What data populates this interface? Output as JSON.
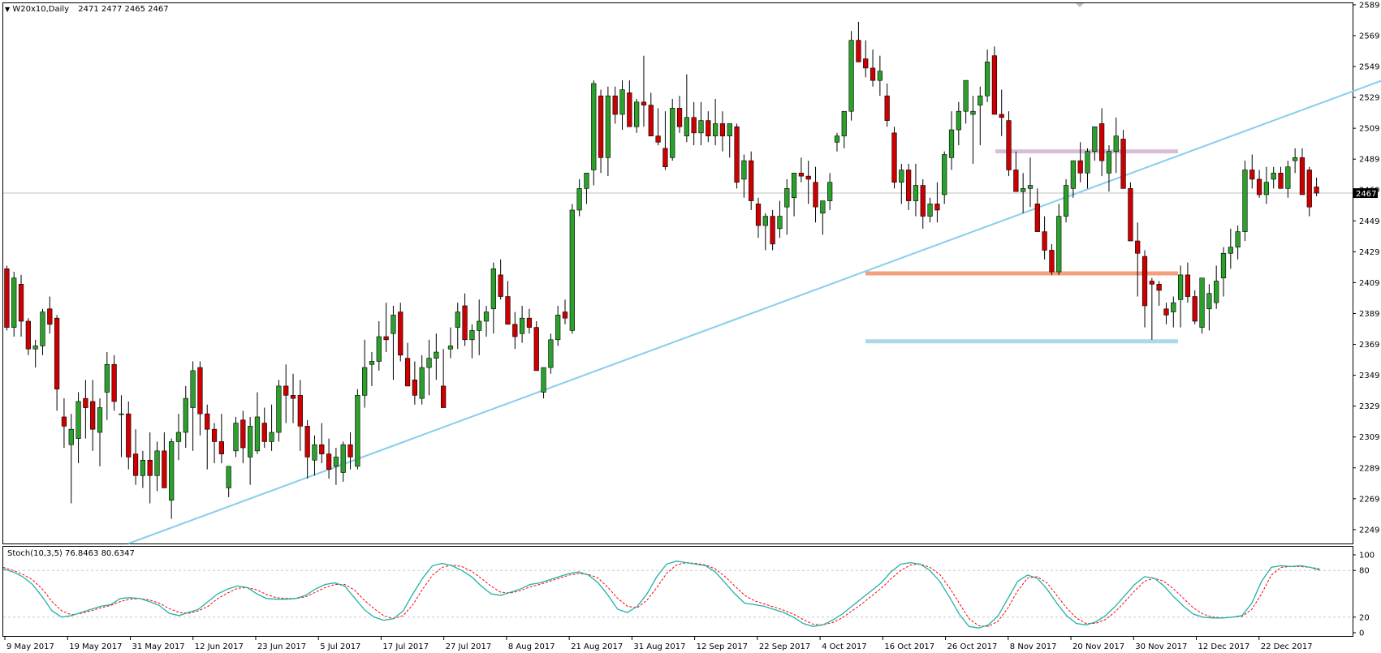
{
  "header": {
    "symbol": "W20x10,Daily",
    "ohlc": "2471 2477 2465 2467"
  },
  "indicator": {
    "title": "Stoch(10,3,5)",
    "values": "76.8463 80.6347",
    "levels": [
      20,
      80
    ],
    "scale": [
      "100",
      "80",
      "20",
      "0"
    ]
  },
  "colors": {
    "bull": "#2ca02c",
    "bear": "#cc0000",
    "trendline": "#87ceeb",
    "resistance_zone": "#d8bfd8",
    "support_mid": "#f4a07c",
    "support_low": "#add8e6",
    "stoch_main": "#20b2aa",
    "stoch_signal": "#ff0000"
  },
  "chart_data": {
    "type": "candlestick",
    "current_price": "2467",
    "ylim": [
      2240,
      2590
    ],
    "y_ticks": [
      2589,
      2569,
      2549,
      2529,
      2509,
      2489,
      2469,
      2449,
      2429,
      2409,
      2389,
      2369,
      2349,
      2329,
      2309,
      2289,
      2269,
      2249
    ],
    "x_ticks": [
      "9 May 2017",
      "19 May 2017",
      "31 May 2017",
      "12 Jun 2017",
      "23 Jun 2017",
      "5 Jul 2017",
      "17 Jul 2017",
      "27 Jul 2017",
      "8 Aug 2017",
      "21 Aug 2017",
      "31 Aug 2017",
      "12 Sep 2017",
      "22 Sep 2017",
      "4 Oct 2017",
      "16 Oct 2017",
      "26 Oct 2017",
      "8 Nov 2017",
      "20 Nov 2017",
      "30 Nov 2017",
      "12 Dec 2017",
      "22 Dec 2017"
    ],
    "horizontal_levels": [
      {
        "price": 2494,
        "role": "resistance"
      },
      {
        "price": 2415,
        "role": "support"
      },
      {
        "price": 2371,
        "role": "support"
      }
    ],
    "trendline": {
      "start": [
        0,
        2240
      ],
      "end": [
        196,
        2566
      ]
    },
    "candles": [
      [
        2418,
        2420,
        2378,
        2380
      ],
      [
        2380,
        2416,
        2374,
        2412
      ],
      [
        2408,
        2414,
        2374,
        2384
      ],
      [
        2384,
        2386,
        2362,
        2366
      ],
      [
        2366,
        2372,
        2354,
        2368
      ],
      [
        2368,
        2392,
        2362,
        2390
      ],
      [
        2392,
        2400,
        2376,
        2382
      ],
      [
        2386,
        2388,
        2326,
        2340
      ],
      [
        2322,
        2334,
        2302,
        2316
      ],
      [
        2304,
        2324,
        2266,
        2314
      ],
      [
        2308,
        2338,
        2292,
        2332
      ],
      [
        2334,
        2346,
        2308,
        2328
      ],
      [
        2332,
        2346,
        2300,
        2314
      ],
      [
        2312,
        2334,
        2290,
        2328
      ],
      [
        2338,
        2364,
        2320,
        2356
      ],
      [
        2356,
        2362,
        2326,
        2332
      ],
      [
        2324,
        2336,
        2296,
        2324
      ],
      [
        2324,
        2332,
        2288,
        2296
      ],
      [
        2298,
        2314,
        2278,
        2284
      ],
      [
        2284,
        2300,
        2276,
        2294
      ],
      [
        2294,
        2312,
        2266,
        2284
      ],
      [
        2284,
        2306,
        2274,
        2300
      ],
      [
        2300,
        2312,
        2282,
        2276
      ],
      [
        2268,
        2308,
        2256,
        2306
      ],
      [
        2306,
        2324,
        2294,
        2312
      ],
      [
        2312,
        2342,
        2302,
        2334
      ],
      [
        2328,
        2358,
        2300,
        2352
      ],
      [
        2354,
        2358,
        2310,
        2324
      ],
      [
        2324,
        2330,
        2288,
        2314
      ],
      [
        2314,
        2318,
        2292,
        2306
      ],
      [
        2306,
        2324,
        2292,
        2298
      ],
      [
        2276,
        2290,
        2270,
        2290
      ],
      [
        2300,
        2322,
        2296,
        2318
      ],
      [
        2320,
        2326,
        2292,
        2302
      ],
      [
        2296,
        2322,
        2278,
        2316
      ],
      [
        2300,
        2338,
        2298,
        2322
      ],
      [
        2318,
        2328,
        2302,
        2306
      ],
      [
        2306,
        2330,
        2300,
        2312
      ],
      [
        2312,
        2346,
        2306,
        2342
      ],
      [
        2342,
        2356,
        2318,
        2336
      ],
      [
        2336,
        2350,
        2318,
        2334
      ],
      [
        2336,
        2346,
        2300,
        2316
      ],
      [
        2316,
        2320,
        2282,
        2296
      ],
      [
        2294,
        2310,
        2284,
        2304
      ],
      [
        2304,
        2318,
        2292,
        2298
      ],
      [
        2298,
        2308,
        2282,
        2288
      ],
      [
        2290,
        2302,
        2278,
        2296
      ],
      [
        2286,
        2306,
        2280,
        2304
      ],
      [
        2304,
        2312,
        2288,
        2296
      ],
      [
        2290,
        2340,
        2288,
        2336
      ],
      [
        2336,
        2372,
        2328,
        2354
      ],
      [
        2356,
        2364,
        2342,
        2358
      ],
      [
        2358,
        2384,
        2352,
        2374
      ],
      [
        2374,
        2396,
        2364,
        2372
      ],
      [
        2376,
        2394,
        2346,
        2388
      ],
      [
        2390,
        2396,
        2358,
        2362
      ],
      [
        2360,
        2370,
        2346,
        2342
      ],
      [
        2346,
        2358,
        2330,
        2336
      ],
      [
        2334,
        2362,
        2330,
        2354
      ],
      [
        2354,
        2372,
        2336,
        2360
      ],
      [
        2360,
        2376,
        2346,
        2364
      ],
      [
        2342,
        2366,
        2332,
        2328
      ],
      [
        2366,
        2380,
        2360,
        2368
      ],
      [
        2380,
        2396,
        2366,
        2390
      ],
      [
        2394,
        2402,
        2368,
        2372
      ],
      [
        2372,
        2382,
        2360,
        2378
      ],
      [
        2378,
        2398,
        2362,
        2384
      ],
      [
        2384,
        2394,
        2374,
        2390
      ],
      [
        2392,
        2422,
        2376,
        2418
      ],
      [
        2414,
        2424,
        2398,
        2400
      ],
      [
        2400,
        2410,
        2386,
        2382
      ],
      [
        2382,
        2390,
        2366,
        2374
      ],
      [
        2376,
        2394,
        2370,
        2386
      ],
      [
        2386,
        2392,
        2376,
        2380
      ],
      [
        2380,
        2384,
        2356,
        2352
      ],
      [
        2338,
        2342,
        2334,
        2354
      ],
      [
        2354,
        2376,
        2350,
        2372
      ],
      [
        2372,
        2394,
        2368,
        2388
      ],
      [
        2390,
        2398,
        2382,
        2386
      ],
      [
        2378,
        2460,
        2376,
        2456
      ],
      [
        2456,
        2476,
        2452,
        2470
      ],
      [
        2470,
        2478,
        2460,
        2480
      ],
      [
        2482,
        2540,
        2472,
        2538
      ],
      [
        2530,
        2534,
        2480,
        2490
      ],
      [
        2490,
        2536,
        2478,
        2530
      ],
      [
        2530,
        2536,
        2512,
        2518
      ],
      [
        2518,
        2540,
        2508,
        2534
      ],
      [
        2532,
        2540,
        2510,
        2510
      ],
      [
        2510,
        2528,
        2506,
        2526
      ],
      [
        2526,
        2556,
        2510,
        2524
      ],
      [
        2524,
        2532,
        2510,
        2504
      ],
      [
        2504,
        2522,
        2498,
        2500
      ],
      [
        2496,
        2520,
        2482,
        2484
      ],
      [
        2490,
        2528,
        2488,
        2522
      ],
      [
        2522,
        2530,
        2506,
        2510
      ],
      [
        2504,
        2544,
        2500,
        2516
      ],
      [
        2516,
        2526,
        2498,
        2506
      ],
      [
        2506,
        2526,
        2498,
        2514
      ],
      [
        2514,
        2520,
        2500,
        2504
      ],
      [
        2504,
        2528,
        2498,
        2512
      ],
      [
        2512,
        2520,
        2494,
        2504
      ],
      [
        2504,
        2512,
        2490,
        2512
      ],
      [
        2510,
        2512,
        2470,
        2474
      ],
      [
        2476,
        2492,
        2464,
        2488
      ],
      [
        2488,
        2494,
        2456,
        2462
      ],
      [
        2460,
        2464,
        2438,
        2446
      ],
      [
        2446,
        2454,
        2430,
        2452
      ],
      [
        2452,
        2456,
        2430,
        2434
      ],
      [
        2444,
        2462,
        2438,
        2452
      ],
      [
        2458,
        2476,
        2440,
        2470
      ],
      [
        2464,
        2474,
        2452,
        2480
      ],
      [
        2480,
        2490,
        2474,
        2478
      ],
      [
        2478,
        2488,
        2460,
        2476
      ],
      [
        2474,
        2484,
        2448,
        2458
      ],
      [
        2454,
        2462,
        2440,
        2462
      ],
      [
        2462,
        2480,
        2456,
        2474
      ],
      [
        2500,
        2506,
        2494,
        2504
      ],
      [
        2504,
        2514,
        2496,
        2520
      ],
      [
        2520,
        2572,
        2514,
        2566
      ],
      [
        2566,
        2578,
        2552,
        2552
      ],
      [
        2554,
        2566,
        2542,
        2548
      ],
      [
        2548,
        2560,
        2536,
        2540
      ],
      [
        2540,
        2556,
        2530,
        2546
      ],
      [
        2530,
        2538,
        2510,
        2514
      ],
      [
        2506,
        2510,
        2470,
        2474
      ],
      [
        2474,
        2486,
        2460,
        2482
      ],
      [
        2482,
        2486,
        2456,
        2462
      ],
      [
        2462,
        2486,
        2452,
        2472
      ],
      [
        2472,
        2476,
        2444,
        2452
      ],
      [
        2452,
        2464,
        2448,
        2460
      ],
      [
        2460,
        2474,
        2448,
        2456
      ],
      [
        2466,
        2494,
        2460,
        2492
      ],
      [
        2490,
        2520,
        2482,
        2508
      ],
      [
        2508,
        2526,
        2498,
        2520
      ],
      [
        2520,
        2536,
        2512,
        2540
      ],
      [
        2518,
        2530,
        2486,
        2520
      ],
      [
        2524,
        2536,
        2498,
        2530
      ],
      [
        2530,
        2560,
        2526,
        2552
      ],
      [
        2556,
        2562,
        2520,
        2518
      ],
      [
        2518,
        2534,
        2504,
        2516
      ],
      [
        2514,
        2520,
        2478,
        2482
      ],
      [
        2482,
        2494,
        2468,
        2468
      ],
      [
        2468,
        2480,
        2454,
        2470
      ],
      [
        2470,
        2490,
        2458,
        2472
      ],
      [
        2460,
        2470,
        2452,
        2442
      ],
      [
        2442,
        2452,
        2424,
        2430
      ],
      [
        2430,
        2434,
        2414,
        2416
      ],
      [
        2416,
        2460,
        2414,
        2452
      ],
      [
        2452,
        2476,
        2448,
        2472
      ],
      [
        2470,
        2484,
        2464,
        2488
      ],
      [
        2488,
        2500,
        2474,
        2480
      ],
      [
        2480,
        2496,
        2470,
        2494
      ],
      [
        2494,
        2506,
        2488,
        2510
      ],
      [
        2512,
        2522,
        2478,
        2488
      ],
      [
        2480,
        2498,
        2468,
        2494
      ],
      [
        2494,
        2516,
        2480,
        2504
      ],
      [
        2502,
        2508,
        2476,
        2470
      ],
      [
        2470,
        2474,
        2436,
        2436
      ],
      [
        2436,
        2448,
        2400,
        2428
      ],
      [
        2426,
        2430,
        2380,
        2394
      ],
      [
        2410,
        2412,
        2372,
        2408
      ],
      [
        2408,
        2410,
        2394,
        2404
      ],
      [
        2392,
        2396,
        2382,
        2388
      ],
      [
        2390,
        2400,
        2380,
        2396
      ],
      [
        2398,
        2420,
        2380,
        2414
      ],
      [
        2414,
        2422,
        2396,
        2400
      ],
      [
        2400,
        2404,
        2382,
        2384
      ],
      [
        2380,
        2410,
        2376,
        2412
      ],
      [
        2392,
        2408,
        2378,
        2402
      ],
      [
        2396,
        2420,
        2392,
        2410
      ],
      [
        2412,
        2432,
        2400,
        2428
      ],
      [
        2428,
        2444,
        2418,
        2432
      ],
      [
        2432,
        2446,
        2424,
        2442
      ],
      [
        2442,
        2488,
        2436,
        2482
      ],
      [
        2482,
        2492,
        2470,
        2476
      ],
      [
        2476,
        2482,
        2464,
        2466
      ],
      [
        2466,
        2484,
        2460,
        2474
      ],
      [
        2476,
        2484,
        2470,
        2480
      ],
      [
        2480,
        2484,
        2470,
        2470
      ],
      [
        2470,
        2488,
        2464,
        2484
      ],
      [
        2488,
        2496,
        2480,
        2490
      ],
      [
        2490,
        2496,
        2468,
        2466
      ],
      [
        2482,
        2484,
        2452,
        2458
      ],
      [
        2471,
        2477,
        2465,
        2467
      ]
    ],
    "stoch_main": [
      82,
      78,
      72,
      62,
      46,
      28,
      20,
      22,
      26,
      30,
      34,
      36,
      44,
      45,
      44,
      40,
      35,
      25,
      22,
      26,
      30,
      40,
      50,
      56,
      60,
      58,
      50,
      44,
      43,
      43,
      44,
      48,
      56,
      62,
      64,
      60,
      45,
      30,
      20,
      16,
      18,
      28,
      50,
      70,
      86,
      89,
      86,
      80,
      72,
      60,
      50,
      48,
      52,
      56,
      62,
      64,
      68,
      72,
      76,
      78,
      74,
      64,
      48,
      30,
      26,
      34,
      50,
      72,
      88,
      92,
      90,
      88,
      86,
      78,
      64,
      50,
      38,
      36,
      34,
      30,
      26,
      20,
      12,
      8,
      10,
      16,
      24,
      34,
      44,
      54,
      64,
      78,
      88,
      90,
      88,
      80,
      66,
      46,
      24,
      8,
      6,
      10,
      22,
      44,
      66,
      74,
      70,
      56,
      38,
      22,
      12,
      10,
      14,
      22,
      34,
      48,
      62,
      72,
      70,
      60,
      46,
      34,
      24,
      20,
      19,
      19,
      20,
      22,
      38,
      66,
      84,
      86,
      85,
      86,
      84,
      80
    ],
    "stoch_signal": [
      84,
      80,
      75,
      68,
      56,
      40,
      28,
      23,
      25,
      28,
      32,
      35,
      40,
      43,
      44,
      42,
      38,
      31,
      26,
      25,
      28,
      34,
      44,
      51,
      57,
      58,
      55,
      49,
      45,
      44,
      44,
      46,
      52,
      58,
      62,
      62,
      55,
      42,
      31,
      22,
      18,
      22,
      36,
      56,
      74,
      84,
      87,
      85,
      79,
      70,
      60,
      52,
      51,
      54,
      59,
      62,
      66,
      70,
      74,
      76,
      75,
      70,
      58,
      44,
      34,
      32,
      42,
      58,
      76,
      87,
      90,
      89,
      87,
      82,
      72,
      60,
      48,
      41,
      37,
      33,
      29,
      24,
      17,
      11,
      10,
      13,
      19,
      28,
      37,
      47,
      57,
      69,
      80,
      87,
      88,
      84,
      75,
      58,
      38,
      18,
      9,
      8,
      15,
      32,
      54,
      70,
      72,
      64,
      48,
      32,
      19,
      12,
      12,
      17,
      27,
      40,
      54,
      66,
      70,
      66,
      56,
      44,
      32,
      24,
      20,
      19,
      20,
      21,
      30,
      50,
      74,
      84,
      85,
      85,
      84,
      82
    ]
  }
}
